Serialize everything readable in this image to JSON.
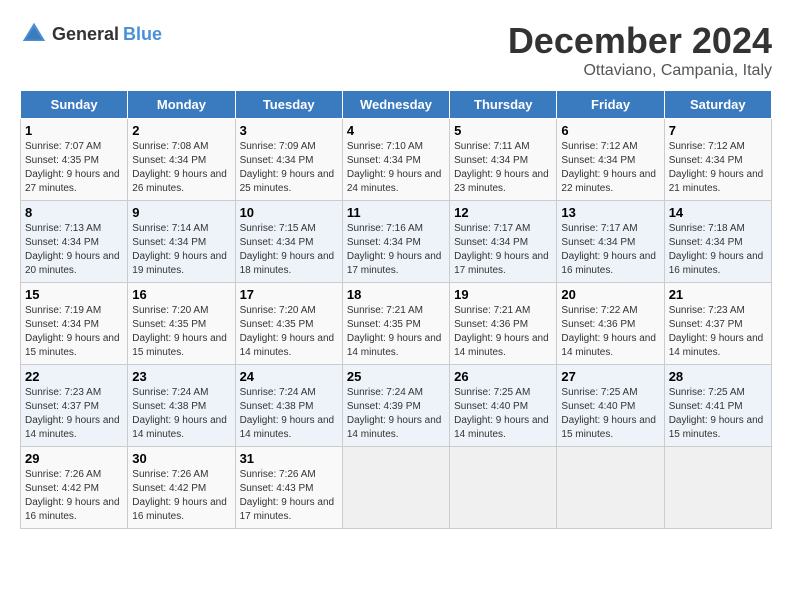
{
  "logo": {
    "general": "General",
    "blue": "Blue"
  },
  "title": {
    "month": "December 2024",
    "location": "Ottaviano, Campania, Italy"
  },
  "headers": [
    "Sunday",
    "Monday",
    "Tuesday",
    "Wednesday",
    "Thursday",
    "Friday",
    "Saturday"
  ],
  "weeks": [
    [
      {
        "day": "1",
        "sunrise": "7:07 AM",
        "sunset": "4:35 PM",
        "daylight": "9 hours and 27 minutes"
      },
      {
        "day": "2",
        "sunrise": "7:08 AM",
        "sunset": "4:34 PM",
        "daylight": "9 hours and 26 minutes"
      },
      {
        "day": "3",
        "sunrise": "7:09 AM",
        "sunset": "4:34 PM",
        "daylight": "9 hours and 25 minutes"
      },
      {
        "day": "4",
        "sunrise": "7:10 AM",
        "sunset": "4:34 PM",
        "daylight": "9 hours and 24 minutes"
      },
      {
        "day": "5",
        "sunrise": "7:11 AM",
        "sunset": "4:34 PM",
        "daylight": "9 hours and 23 minutes"
      },
      {
        "day": "6",
        "sunrise": "7:12 AM",
        "sunset": "4:34 PM",
        "daylight": "9 hours and 22 minutes"
      },
      {
        "day": "7",
        "sunrise": "7:12 AM",
        "sunset": "4:34 PM",
        "daylight": "9 hours and 21 minutes"
      }
    ],
    [
      {
        "day": "8",
        "sunrise": "7:13 AM",
        "sunset": "4:34 PM",
        "daylight": "9 hours and 20 minutes"
      },
      {
        "day": "9",
        "sunrise": "7:14 AM",
        "sunset": "4:34 PM",
        "daylight": "9 hours and 19 minutes"
      },
      {
        "day": "10",
        "sunrise": "7:15 AM",
        "sunset": "4:34 PM",
        "daylight": "9 hours and 18 minutes"
      },
      {
        "day": "11",
        "sunrise": "7:16 AM",
        "sunset": "4:34 PM",
        "daylight": "9 hours and 17 minutes"
      },
      {
        "day": "12",
        "sunrise": "7:17 AM",
        "sunset": "4:34 PM",
        "daylight": "9 hours and 17 minutes"
      },
      {
        "day": "13",
        "sunrise": "7:17 AM",
        "sunset": "4:34 PM",
        "daylight": "9 hours and 16 minutes"
      },
      {
        "day": "14",
        "sunrise": "7:18 AM",
        "sunset": "4:34 PM",
        "daylight": "9 hours and 16 minutes"
      }
    ],
    [
      {
        "day": "15",
        "sunrise": "7:19 AM",
        "sunset": "4:34 PM",
        "daylight": "9 hours and 15 minutes"
      },
      {
        "day": "16",
        "sunrise": "7:20 AM",
        "sunset": "4:35 PM",
        "daylight": "9 hours and 15 minutes"
      },
      {
        "day": "17",
        "sunrise": "7:20 AM",
        "sunset": "4:35 PM",
        "daylight": "9 hours and 14 minutes"
      },
      {
        "day": "18",
        "sunrise": "7:21 AM",
        "sunset": "4:35 PM",
        "daylight": "9 hours and 14 minutes"
      },
      {
        "day": "19",
        "sunrise": "7:21 AM",
        "sunset": "4:36 PM",
        "daylight": "9 hours and 14 minutes"
      },
      {
        "day": "20",
        "sunrise": "7:22 AM",
        "sunset": "4:36 PM",
        "daylight": "9 hours and 14 minutes"
      },
      {
        "day": "21",
        "sunrise": "7:23 AM",
        "sunset": "4:37 PM",
        "daylight": "9 hours and 14 minutes"
      }
    ],
    [
      {
        "day": "22",
        "sunrise": "7:23 AM",
        "sunset": "4:37 PM",
        "daylight": "9 hours and 14 minutes"
      },
      {
        "day": "23",
        "sunrise": "7:24 AM",
        "sunset": "4:38 PM",
        "daylight": "9 hours and 14 minutes"
      },
      {
        "day": "24",
        "sunrise": "7:24 AM",
        "sunset": "4:38 PM",
        "daylight": "9 hours and 14 minutes"
      },
      {
        "day": "25",
        "sunrise": "7:24 AM",
        "sunset": "4:39 PM",
        "daylight": "9 hours and 14 minutes"
      },
      {
        "day": "26",
        "sunrise": "7:25 AM",
        "sunset": "4:40 PM",
        "daylight": "9 hours and 14 minutes"
      },
      {
        "day": "27",
        "sunrise": "7:25 AM",
        "sunset": "4:40 PM",
        "daylight": "9 hours and 15 minutes"
      },
      {
        "day": "28",
        "sunrise": "7:25 AM",
        "sunset": "4:41 PM",
        "daylight": "9 hours and 15 minutes"
      }
    ],
    [
      {
        "day": "29",
        "sunrise": "7:26 AM",
        "sunset": "4:42 PM",
        "daylight": "9 hours and 16 minutes"
      },
      {
        "day": "30",
        "sunrise": "7:26 AM",
        "sunset": "4:42 PM",
        "daylight": "9 hours and 16 minutes"
      },
      {
        "day": "31",
        "sunrise": "7:26 AM",
        "sunset": "4:43 PM",
        "daylight": "9 hours and 17 minutes"
      },
      null,
      null,
      null,
      null
    ]
  ]
}
